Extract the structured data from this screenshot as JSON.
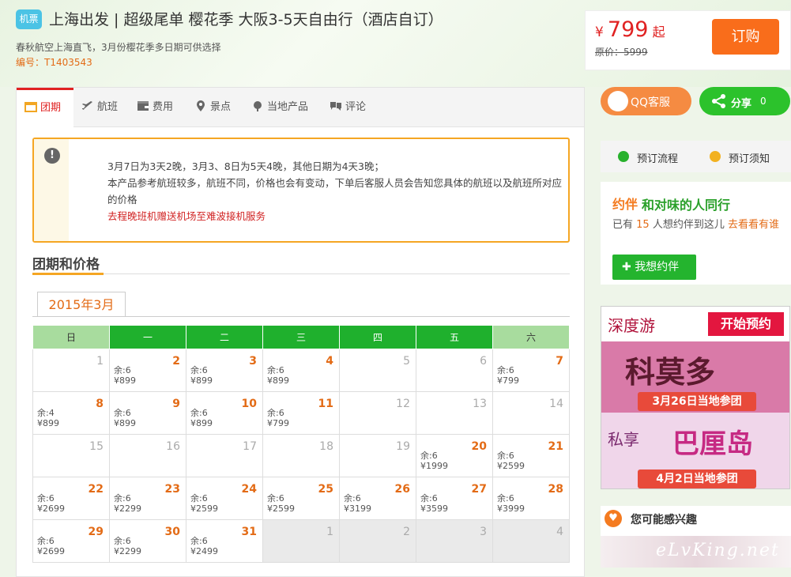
{
  "header": {
    "tag": "机票",
    "title": "上海出发 | 超级尾单 樱花季 大阪3-5天自由行（酒店自订）",
    "subtitle": "春秋航空上海直飞，3月份樱花季多日期可供选择",
    "code_label": "编号：",
    "code": "T1403543"
  },
  "pricebox": {
    "currency": "¥",
    "price": "799",
    "suffix": "起",
    "original": "原价：5999",
    "order_label": "订购"
  },
  "tabs": [
    {
      "label": "团期",
      "icon": "calendar-icon",
      "active": true
    },
    {
      "label": "航班",
      "icon": "plane-icon"
    },
    {
      "label": "费用",
      "icon": "wallet-icon"
    },
    {
      "label": "景点",
      "icon": "location-pin-icon"
    },
    {
      "label": "当地产品",
      "icon": "local-product-icon"
    },
    {
      "label": "评论",
      "icon": "comment-icon"
    }
  ],
  "notice": {
    "lines": [
      "3月7日为3天2晚，3月3、8日为5天4晚，其他日期为4天3晚；",
      "本产品参考航班较多，航班不同，价格也会有变动，下单后客服人员会告知您具体的航班以及航班所对应的价格"
    ],
    "highlight": "去程晚班机赠送机场至难波接机服务"
  },
  "section_title": "团期和价格",
  "month": "2015年3月",
  "calendar": {
    "weekdays": [
      "日",
      "一",
      "二",
      "三",
      "四",
      "五",
      "六"
    ],
    "weeks": [
      [
        {
          "d": "1"
        },
        {
          "d": "2",
          "r": "余:6",
          "p": "¥899"
        },
        {
          "d": "3",
          "r": "余:6",
          "p": "¥899"
        },
        {
          "d": "4",
          "r": "余:6",
          "p": "¥899"
        },
        {
          "d": "5"
        },
        {
          "d": "6"
        },
        {
          "d": "7",
          "r": "余:6",
          "p": "¥799"
        }
      ],
      [
        {
          "d": "8",
          "r": "余:4",
          "p": "¥899"
        },
        {
          "d": "9",
          "r": "余:6",
          "p": "¥899"
        },
        {
          "d": "10",
          "r": "余:6",
          "p": "¥899"
        },
        {
          "d": "11",
          "r": "余:6",
          "p": "¥799"
        },
        {
          "d": "12"
        },
        {
          "d": "13"
        },
        {
          "d": "14"
        }
      ],
      [
        {
          "d": "15"
        },
        {
          "d": "16"
        },
        {
          "d": "17"
        },
        {
          "d": "18"
        },
        {
          "d": "19"
        },
        {
          "d": "20",
          "r": "余:6",
          "p": "¥1999"
        },
        {
          "d": "21",
          "r": "余:6",
          "p": "¥2599"
        }
      ],
      [
        {
          "d": "22",
          "r": "余:6",
          "p": "¥2699"
        },
        {
          "d": "23",
          "r": "余:6",
          "p": "¥2299"
        },
        {
          "d": "24",
          "r": "余:6",
          "p": "¥2599"
        },
        {
          "d": "25",
          "r": "余:6",
          "p": "¥2599"
        },
        {
          "d": "26",
          "r": "余:6",
          "p": "¥3199"
        },
        {
          "d": "27",
          "r": "余:6",
          "p": "¥3599"
        },
        {
          "d": "28",
          "r": "余:6",
          "p": "¥3999"
        }
      ],
      [
        {
          "d": "29",
          "r": "余:6",
          "p": "¥2699"
        },
        {
          "d": "30",
          "r": "余:6",
          "p": "¥2299"
        },
        {
          "d": "31",
          "r": "余:6",
          "p": "¥2499"
        },
        {
          "d": "1",
          "g": true
        },
        {
          "d": "2",
          "g": true
        },
        {
          "d": "3",
          "g": true
        },
        {
          "d": "4",
          "g": true
        }
      ]
    ]
  },
  "sidebar": {
    "qq_label": "QQ客服",
    "share_label": "分享",
    "share_count": "0",
    "flow_label": "预订流程",
    "notice_label": "预订须知",
    "yue_logo": "约伴",
    "yue_title": "和对味的人同行",
    "yue_pre": "已有",
    "yue_count": "15",
    "yue_mid": "人想约伴到这儿",
    "yue_link": "去看看有谁",
    "yue_btn": "我想约伴",
    "ad_top_left": "深度游",
    "ad_top_btn": "开始预约",
    "ad_mid_big": "科莫多",
    "ad_mid_pill": "3月26日当地参团",
    "ad_bot_small": "私享",
    "ad_bot_big": "巴厘岛",
    "ad_bot_pill": "4月2日当地参团",
    "interest_title": "您可能感兴趣",
    "watermark": "eLvKing.net"
  }
}
